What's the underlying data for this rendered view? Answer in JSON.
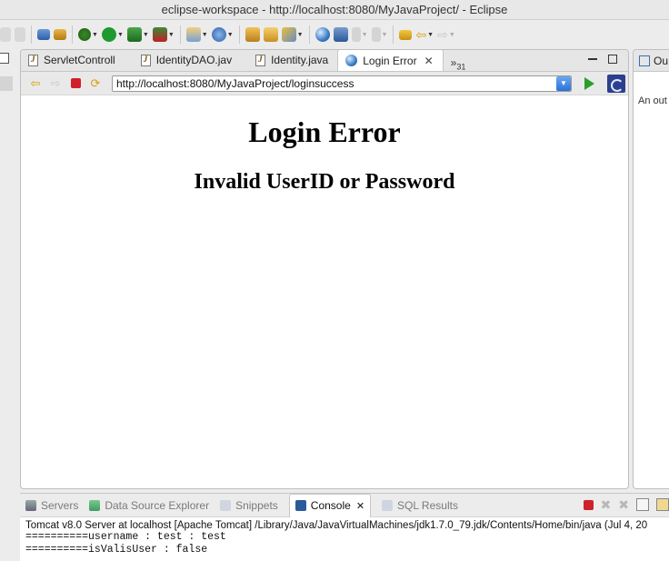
{
  "window": {
    "title": "eclipse-workspace - http://localhost:8080/MyJavaProject/ - Eclipse"
  },
  "colors": {
    "accent": "#2a72d8",
    "stop": "#d0202a",
    "run": "#2aa02a"
  },
  "toolbar": {
    "icons": [
      "back-icon",
      "forward-icon",
      "new-icon",
      "save-icon",
      "debug-icon",
      "run-icon",
      "run-server-icon",
      "stop-server-icon",
      "new-class-icon",
      "new-package-icon",
      "open-folder-icon",
      "open-file-icon",
      "search-icon",
      "globe-icon",
      "next-annotation-icon",
      "prev-annotation-icon",
      "last-edit-icon",
      "back-history-icon",
      "forward-history-icon"
    ]
  },
  "editor": {
    "tabs": [
      {
        "label": "ServletControll"
      },
      {
        "label": "IdentityDAO.jav"
      },
      {
        "label": "Identity.java"
      },
      {
        "label": "Login Error",
        "active": true
      }
    ],
    "overflow_label": "»",
    "overflow_count": "31",
    "url": "http://localhost:8080/MyJavaProject/loginsuccess"
  },
  "page": {
    "heading": "Login Error",
    "subheading": "Invalid UserID or Password"
  },
  "outline": {
    "tab_label": "Ou",
    "text": "An out"
  },
  "console": {
    "tabs": [
      {
        "label": "Servers"
      },
      {
        "label": "Data Source Explorer"
      },
      {
        "label": "Snippets"
      },
      {
        "label": "Console",
        "active": true
      },
      {
        "label": "SQL Results"
      }
    ],
    "process_label": "Tomcat v8.0 Server at localhost [Apache Tomcat] /Library/Java/JavaVirtualMachines/jdk1.7.0_79.jdk/Contents/Home/bin/java (Jul 4, 20",
    "lines": [
      "==========username : test : test",
      "==========isValisUser : false"
    ]
  }
}
